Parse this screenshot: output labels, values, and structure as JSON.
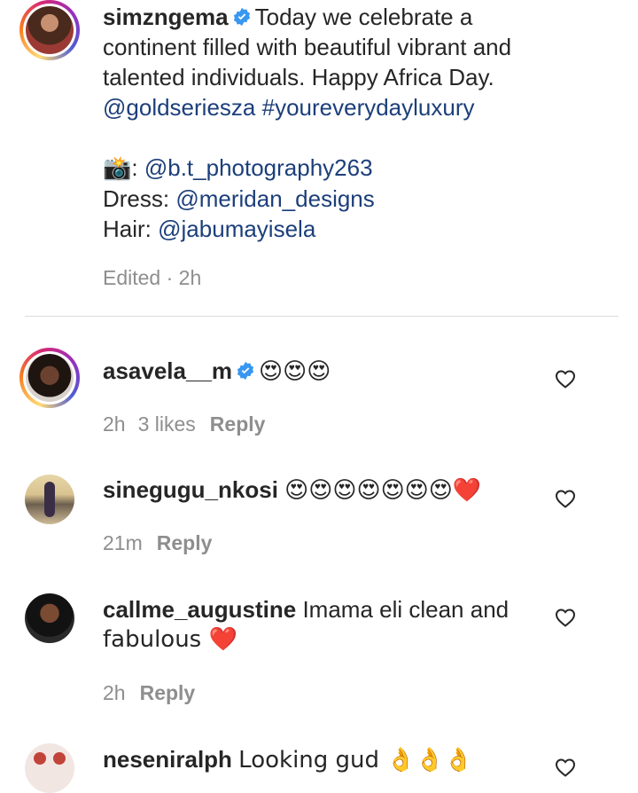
{
  "post": {
    "username": "simzngema",
    "caption_line1": "Today we celebrate a",
    "caption_line2": "continent filled with beautiful vibrant and",
    "caption_line3": "talented individuals. Happy Africa Day.",
    "tag1": "@goldseriesza",
    "hashtag": "#youreverydayluxury",
    "photo_credit_icon": "📸",
    "photo_credit_sep": ":",
    "photo_credit": "@b.t_photography263",
    "dress_label": "Dress:",
    "dress_credit": "@meridan_designs",
    "hair_label": "Hair:",
    "hair_credit": "@jabumayisela",
    "edited_meta": "Edited · 2h"
  },
  "comments": [
    {
      "username": "asavela__m",
      "verified": true,
      "text": "😍😍😍",
      "time": "2h",
      "likes": "3 likes",
      "reply": "Reply"
    },
    {
      "username": "sinegugu_nkosi",
      "verified": false,
      "text": "😍😍😍😍😍😍😍❤️",
      "time": "21m",
      "reply": "Reply"
    },
    {
      "username": "callme_augustine",
      "verified": false,
      "text_line1": "Imama eli clean and",
      "text_line2": "fabulous ❤️",
      "time": "2h",
      "reply": "Reply"
    },
    {
      "username": "neseniralph",
      "verified": false,
      "text": "Looking gud 👌👌👌"
    }
  ],
  "colors": {
    "text": "#262626",
    "link": "#1c3f7a",
    "meta": "#8e8e8e",
    "verified": "#3897f0",
    "divider": "#dbdbdb"
  }
}
